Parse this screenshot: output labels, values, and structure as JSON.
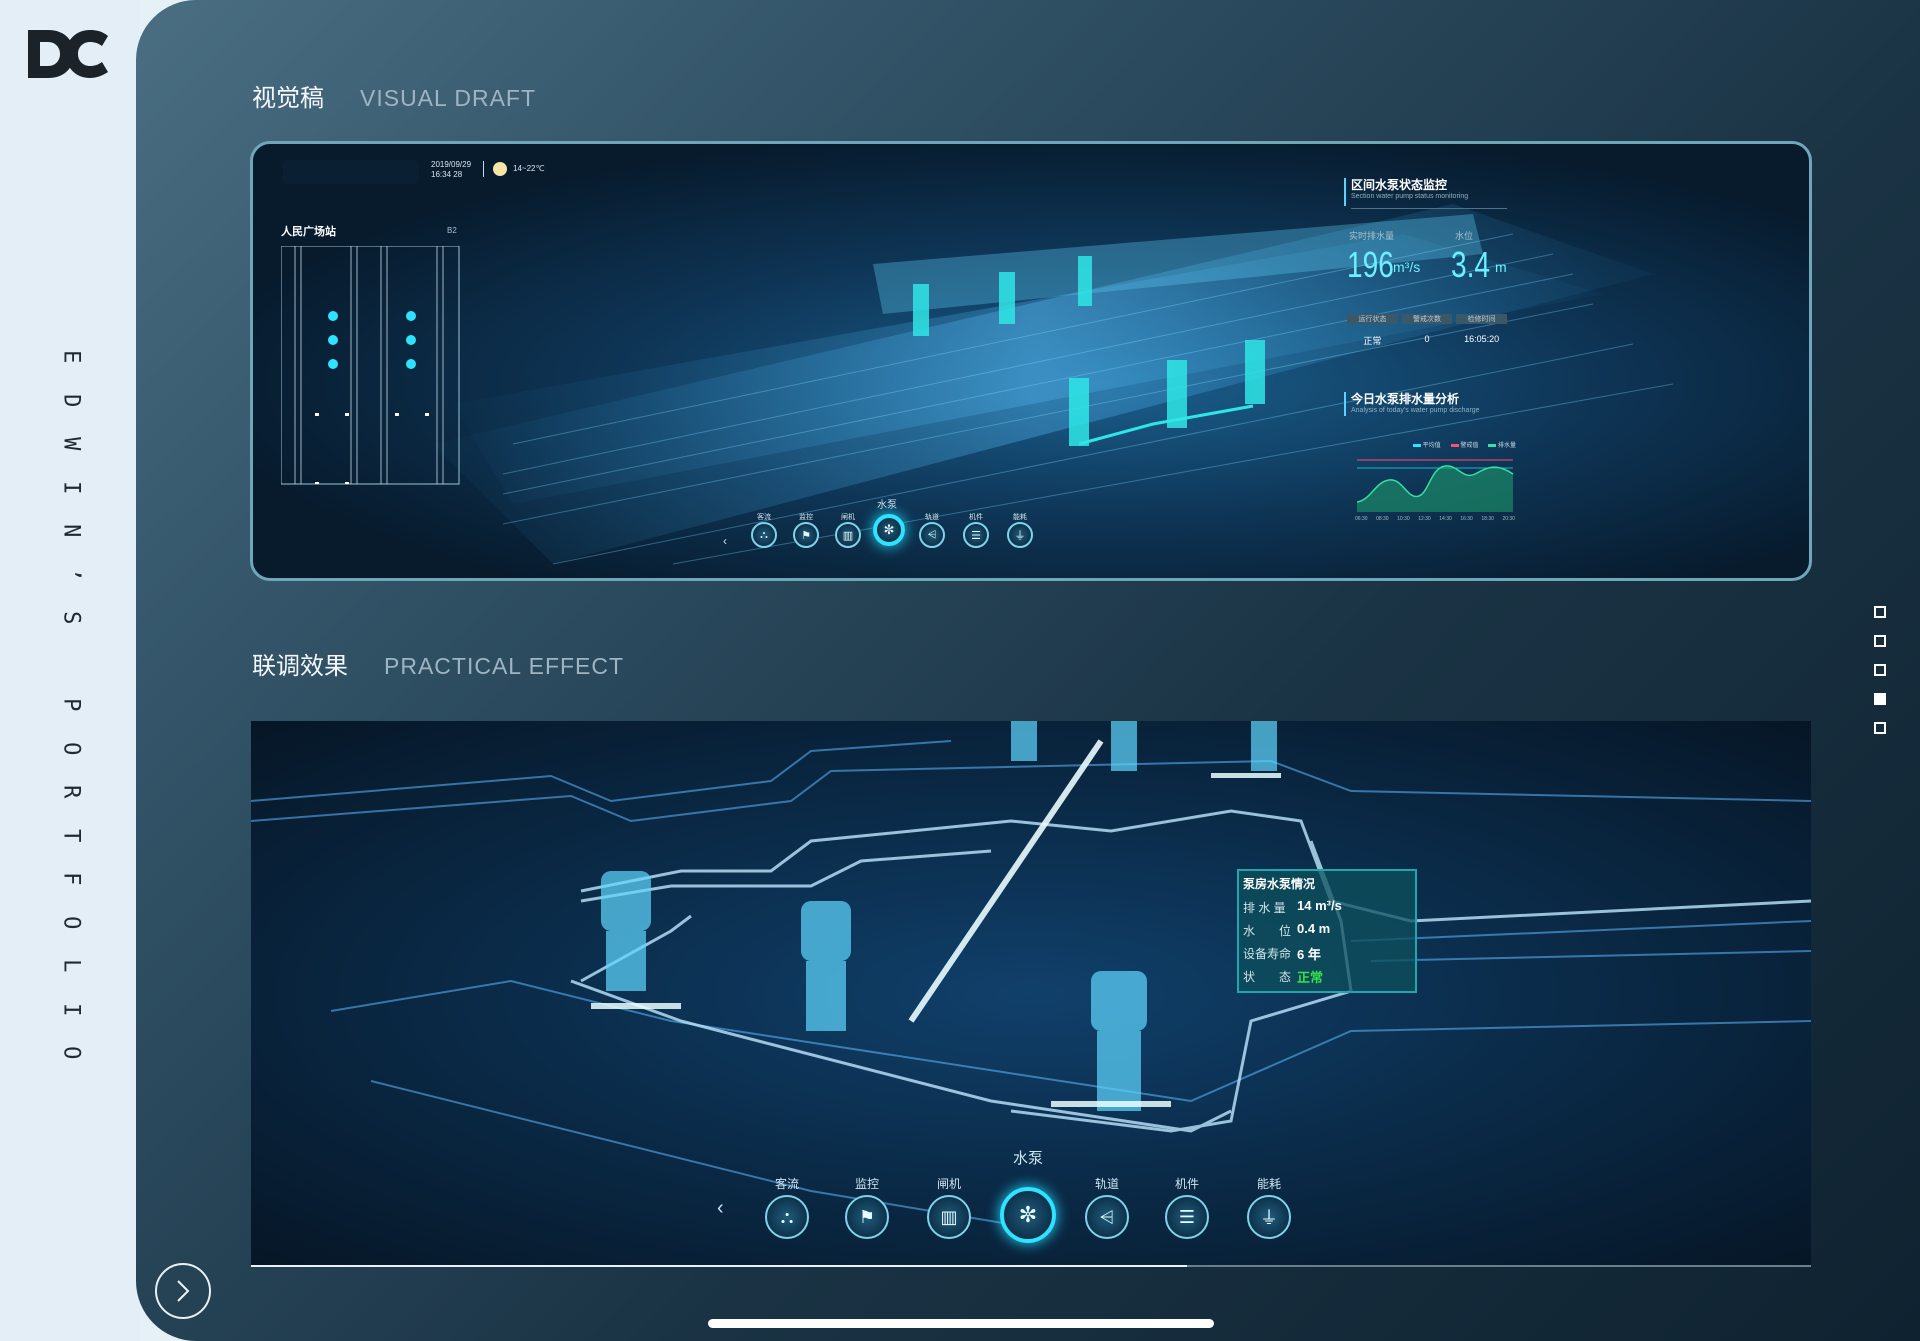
{
  "sidebar": {
    "logo_text": "DC",
    "vertical_title": [
      "E",
      "D",
      "W",
      "I",
      "N",
      "’",
      "S",
      "",
      "P",
      "O",
      "R",
      "T",
      "F",
      "O",
      "L",
      "I",
      "O"
    ]
  },
  "section1": {
    "title_cn": "视觉稿",
    "title_en": "VISUAL DRAFT"
  },
  "section2": {
    "title_cn": "联调效果",
    "title_en": "PRACTICAL EFFECT"
  },
  "draft": {
    "date": "2019/09/29",
    "time": "16:34 28",
    "weather": "14~22℃",
    "station_name": "人民广场站",
    "station_level": "B2",
    "panel_title": "区间水泵状态监控",
    "panel_subtitle": "Section water pump status monitoring",
    "realtime_label": "实时排水量",
    "level_label": "水位",
    "flow_value": "196",
    "flow_unit": "m³/s",
    "level_value": "3.4",
    "level_unit": "m",
    "table_headers": [
      "运行状态",
      "警戒次数",
      "检修时间"
    ],
    "table_values": [
      "正常",
      "0",
      "16:05:20"
    ],
    "analysis_title": "今日水泵排水量分析",
    "analysis_subtitle": "Analysis of today's water pump discharge",
    "legend": [
      "平均值",
      "警戒值",
      "排水量"
    ],
    "x_ticks": [
      "06:30",
      "08:30",
      "10:30",
      "12:30",
      "14:30",
      "16:30",
      "18:30",
      "20:30"
    ],
    "active_label": "水泵",
    "nav_labels": [
      "客流",
      "监控",
      "闸机",
      "水泵",
      "轨道",
      "机件",
      "能耗"
    ]
  },
  "effect": {
    "info_title": "泵房水泵情况",
    "rows": [
      {
        "label": "排 水 量",
        "value": "14 m³/s"
      },
      {
        "label": "水　　位",
        "value": "0.4 m"
      },
      {
        "label": "设备寿命",
        "value": "6 年"
      },
      {
        "label": "状　　态",
        "value": "正常"
      }
    ],
    "active_label": "水泵",
    "nav_labels": [
      "客流",
      "监控",
      "闸机",
      "水泵",
      "轨道",
      "机件",
      "能耗"
    ]
  },
  "progress": {
    "fraction": 0.6
  },
  "pagination": {
    "count": 5,
    "active_index": 3
  },
  "colors": {
    "accent": "#2ee3ff",
    "status_ok": "#35e04a"
  }
}
